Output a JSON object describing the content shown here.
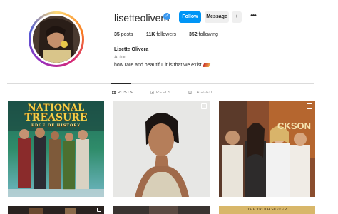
{
  "profile": {
    "username": "lisetteolivera",
    "verified_glyph": "✓",
    "follow_label": "Follow",
    "message_label": "Message",
    "suggest_glyph": "+",
    "more_glyph": "•••",
    "posts_count": "35",
    "posts_label": "posts",
    "followers_count": "11K",
    "followers_label": "followers",
    "following_count": "352",
    "following_label": "following",
    "full_name": "Lisette Olivera",
    "category": "Actor",
    "bio": "how rare and beautiful it is that we exist"
  },
  "tabs": [
    {
      "label": "POSTS",
      "icon": "grid-icon",
      "active": true
    },
    {
      "label": "REELS",
      "icon": "reels-icon",
      "active": false
    },
    {
      "label": "TAGGED",
      "icon": "tagged-icon",
      "active": false
    }
  ],
  "posts": [
    {
      "title_line1": "NATIONAL",
      "title_line2": "TREASURE",
      "title_line3": "EDGE OF HISTORY",
      "multi": false
    },
    {
      "multi": true
    },
    {
      "poster_text": "CKSON",
      "multi": true
    },
    {
      "multi": true
    },
    {
      "multi": false
    },
    {
      "poster_text": "THE TRUTH SEEKER",
      "multi": false
    }
  ],
  "colors": {
    "accent": "#0095f6",
    "verified": "#3897f0",
    "muted": "#8e8e8e",
    "text": "#262626"
  }
}
